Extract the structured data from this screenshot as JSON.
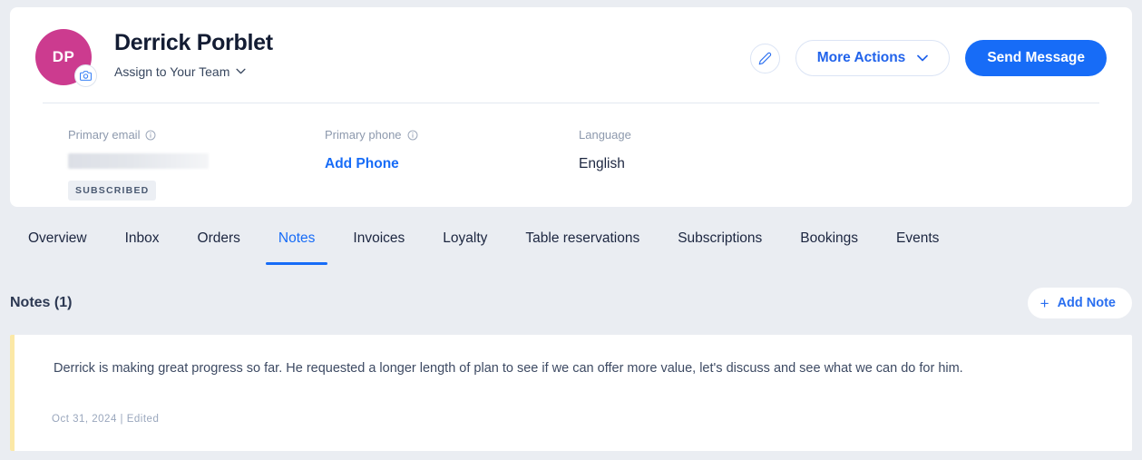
{
  "profile": {
    "avatar_initials": "DP",
    "avatar_color": "#cc3b8f",
    "camera_icon": "camera-icon",
    "name": "Derrick Porblet",
    "assign_label": "Assign to Your Team",
    "assign_chevron_icon": "chevron-down-icon",
    "edit_icon": "pencil-icon",
    "more_actions_label": "More Actions",
    "more_actions_chevron_icon": "chevron-down-icon",
    "send_message_label": "Send Message",
    "primary_button_color": "#176cf7",
    "link_color": "#176cf7"
  },
  "fields": {
    "email": {
      "label": "Primary email",
      "info_icon": "info-icon",
      "value": "",
      "badge": "SUBSCRIBED"
    },
    "phone": {
      "label": "Primary phone",
      "info_icon": "info-icon",
      "action_label": "Add Phone"
    },
    "language": {
      "label": "Language",
      "value": "English"
    }
  },
  "tabs": {
    "active": "Notes",
    "items": [
      {
        "label": "Overview"
      },
      {
        "label": "Inbox"
      },
      {
        "label": "Orders"
      },
      {
        "label": "Notes"
      },
      {
        "label": "Invoices"
      },
      {
        "label": "Loyalty"
      },
      {
        "label": "Table reservations"
      },
      {
        "label": "Subscriptions"
      },
      {
        "label": "Bookings"
      },
      {
        "label": "Events"
      }
    ]
  },
  "notes": {
    "heading": "Notes (1)",
    "add_label": "Add Note",
    "add_icon": "plus-icon",
    "accent_color": "#fbe8a6",
    "items": [
      {
        "text": "Derrick is making great progress so far. He requested a longer length of plan to see if we can offer more value, let's discuss and see what we can do for him.",
        "meta": "Oct 31, 2024 | Edited"
      }
    ]
  }
}
